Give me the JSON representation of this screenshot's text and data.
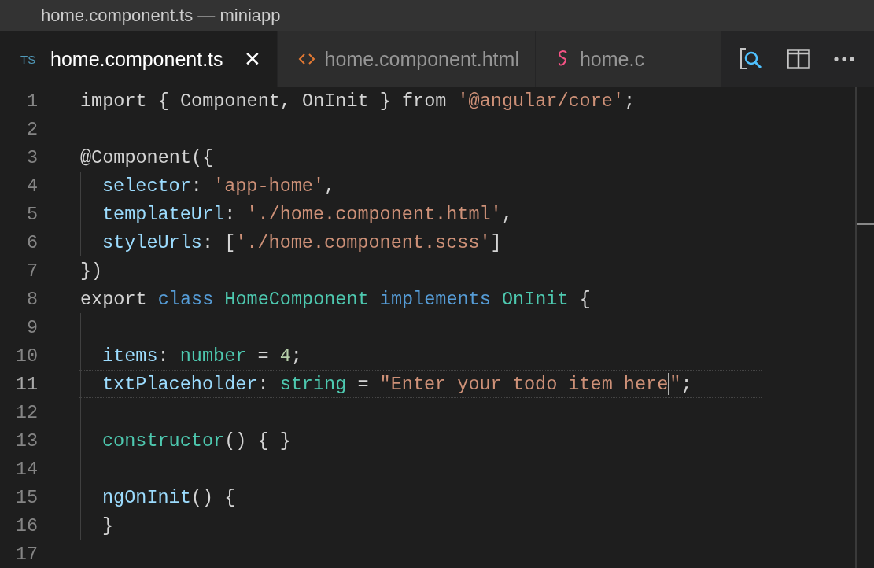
{
  "window": {
    "title": "home.component.ts — miniapp"
  },
  "tabs": [
    {
      "label": "home.component.ts",
      "badge": "TS",
      "selected": true,
      "close": "✕"
    },
    {
      "label": "home.component.html",
      "selected": false
    },
    {
      "label": "home.c",
      "selected": false
    }
  ],
  "editor": {
    "lines": [
      {
        "number": "1",
        "guide": false,
        "current": false,
        "tokens": [
          {
            "kind": "plain",
            "text": "import { Component, OnInit } "
          },
          {
            "kind": "plain",
            "text": "from "
          },
          {
            "kind": "str",
            "text": "'@angular/core'"
          },
          {
            "kind": "plain",
            "text": ";"
          }
        ]
      },
      {
        "number": "2",
        "guide": false,
        "current": false
      },
      {
        "number": "3",
        "guide": false,
        "current": false,
        "tokens": [
          {
            "kind": "plain",
            "text": "@Component({"
          }
        ]
      },
      {
        "number": "4",
        "guide": true,
        "current": false,
        "tokens": [
          {
            "kind": "prop",
            "text": "selector"
          },
          {
            "kind": "plain",
            "text": ": "
          },
          {
            "kind": "str",
            "text": "'app-home'"
          },
          {
            "kind": "plain",
            "text": ","
          }
        ]
      },
      {
        "number": "5",
        "guide": true,
        "current": false,
        "tokens": [
          {
            "kind": "prop",
            "text": "templateUrl"
          },
          {
            "kind": "plain",
            "text": ": "
          },
          {
            "kind": "str",
            "text": "'./home.component.html'"
          },
          {
            "kind": "plain",
            "text": ","
          }
        ]
      },
      {
        "number": "6",
        "guide": true,
        "current": false,
        "tokens": [
          {
            "kind": "prop",
            "text": "styleUrls"
          },
          {
            "kind": "plain",
            "text": ": ["
          },
          {
            "kind": "str",
            "text": "'./home.component.scss'"
          },
          {
            "kind": "plain",
            "text": "]"
          }
        ]
      },
      {
        "number": "7",
        "guide": false,
        "current": false,
        "tokens": [
          {
            "kind": "plain",
            "text": "})"
          }
        ]
      },
      {
        "number": "8",
        "guide": false,
        "current": false,
        "tokens": [
          {
            "kind": "plain",
            "text": "export "
          },
          {
            "kind": "kw",
            "text": "class "
          },
          {
            "kind": "type",
            "text": "HomeComponent "
          },
          {
            "kind": "kw",
            "text": "implements "
          },
          {
            "kind": "type",
            "text": "OnInit "
          },
          {
            "kind": "plain",
            "text": "{"
          }
        ]
      },
      {
        "number": "9",
        "guide": true,
        "current": false
      },
      {
        "number": "10",
        "guide": true,
        "current": false,
        "tokens": [
          {
            "kind": "prop",
            "text": "items"
          },
          {
            "kind": "plain",
            "text": ": "
          },
          {
            "kind": "type",
            "text": "number"
          },
          {
            "kind": "plain",
            "text": " = "
          },
          {
            "kind": "num",
            "text": "4"
          },
          {
            "kind": "plain",
            "text": ";"
          }
        ]
      },
      {
        "number": "11",
        "guide": true,
        "current": true,
        "tokens": [
          {
            "kind": "prop",
            "text": "txtPlaceholder"
          },
          {
            "kind": "plain",
            "text": ": "
          },
          {
            "kind": "type",
            "text": "string"
          },
          {
            "kind": "plain",
            "text": " = "
          },
          {
            "kind": "str",
            "text": "\"Enter your todo item here"
          },
          {
            "kind": "cursor"
          },
          {
            "kind": "str",
            "text": "\""
          },
          {
            "kind": "plain",
            "text": ";"
          }
        ]
      },
      {
        "number": "12",
        "guide": true,
        "current": false
      },
      {
        "number": "13",
        "guide": true,
        "current": false,
        "tokens": [
          {
            "kind": "type",
            "text": "constructor"
          },
          {
            "kind": "plain",
            "text": "() { }"
          }
        ]
      },
      {
        "number": "14",
        "guide": true,
        "current": false
      },
      {
        "number": "15",
        "guide": true,
        "current": false,
        "tokens": [
          {
            "kind": "prop",
            "text": "ngOnInit"
          },
          {
            "kind": "plain",
            "text": "() {"
          }
        ]
      },
      {
        "number": "16",
        "guide": true,
        "current": false,
        "tokens": [
          {
            "kind": "plain",
            "text": "}"
          }
        ]
      },
      {
        "number": "17",
        "guide": false,
        "current": false
      }
    ]
  }
}
